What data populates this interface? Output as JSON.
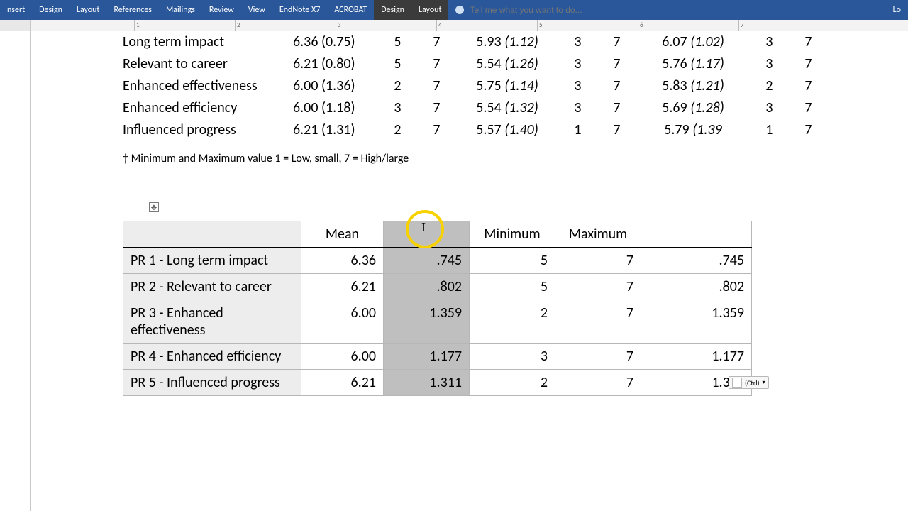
{
  "ribbon": {
    "tabs": [
      "nsert",
      "Design",
      "Layout",
      "References",
      "Mailings",
      "Review",
      "View",
      "EndNote X7",
      "ACROBAT"
    ],
    "context_tabs": [
      "Design",
      "Layout"
    ],
    "tell_placeholder": "Tell me what you want to do...",
    "right": "Lo"
  },
  "ruler_marks": [
    "1",
    "2",
    "3",
    "4",
    "5",
    "6",
    "7"
  ],
  "upper_table": {
    "rows": [
      {
        "label": "Long term impact",
        "c1": "6.36 (0.75)",
        "n1": "5",
        "n2": "7",
        "c2p": "5.93 ",
        "c2i": "(1.12)",
        "n3": "3",
        "n4": "7",
        "c3p": "6.07 ",
        "c3i": "(1.02)",
        "n5": "3",
        "n6": "7"
      },
      {
        "label": "Relevant to career",
        "c1": "6.21 (0.80)",
        "n1": "5",
        "n2": "7",
        "c2p": "5.54 ",
        "c2i": "(1.26)",
        "n3": "3",
        "n4": "7",
        "c3p": "5.76 ",
        "c3i": "(1.17)",
        "n5": "3",
        "n6": "7"
      },
      {
        "label": "Enhanced effectiveness",
        "c1": "6.00 (1.36)",
        "n1": "2",
        "n2": "7",
        "c2p": "5.75 ",
        "c2i": "(1.14)",
        "n3": "3",
        "n4": "7",
        "c3p": "5.83 ",
        "c3i": "(1.21)",
        "n5": "2",
        "n6": "7"
      },
      {
        "label": "Enhanced efficiency",
        "c1": "6.00 (1.18)",
        "n1": "3",
        "n2": "7",
        "c2p": "5.54 ",
        "c2i": "(1.32)",
        "n3": "3",
        "n4": "7",
        "c3p": "5.69 ",
        "c3i": "(1.28)",
        "n5": "3",
        "n6": "7"
      },
      {
        "label": "Influenced progress",
        "c1": "6.21 (1.31)",
        "n1": "2",
        "n2": "7",
        "c2p": "5.57 ",
        "c2i": "(1.40)",
        "n3": "1",
        "n4": "7",
        "c3p": "5.79 ",
        "c3i": "(1.39",
        "n5": "1",
        "n6": "7"
      }
    ],
    "footnote": "† Minimum and Maximum value 1 = Low, small, 7 = High/large"
  },
  "lower_table": {
    "headers": [
      "",
      "Mean",
      "",
      "Minimum",
      "Maximum",
      ""
    ],
    "rows": [
      {
        "label": "PR 1 - Long term impact",
        "mean": "6.36",
        "sd": ".745",
        "min": "5",
        "max": "7",
        "ext": ".745"
      },
      {
        "label": "PR 2 - Relevant to career",
        "mean": "6.21",
        "sd": ".802",
        "min": "5",
        "max": "7",
        "ext": ".802"
      },
      {
        "label": "PR 3 - Enhanced effectiveness",
        "mean": "6.00",
        "sd": "1.359",
        "min": "2",
        "max": "7",
        "ext": "1.359"
      },
      {
        "label": "PR 4 - Enhanced efficiency",
        "mean": "6.00",
        "sd": "1.177",
        "min": "3",
        "max": "7",
        "ext": "1.177"
      },
      {
        "label": "PR 5 - Influenced progress",
        "mean": "6.21",
        "sd": "1.311",
        "min": "2",
        "max": "7",
        "ext": "1.311"
      }
    ]
  },
  "paste_options": {
    "label": "(Ctrl)"
  },
  "table_handle": "✥",
  "cursor": "I"
}
